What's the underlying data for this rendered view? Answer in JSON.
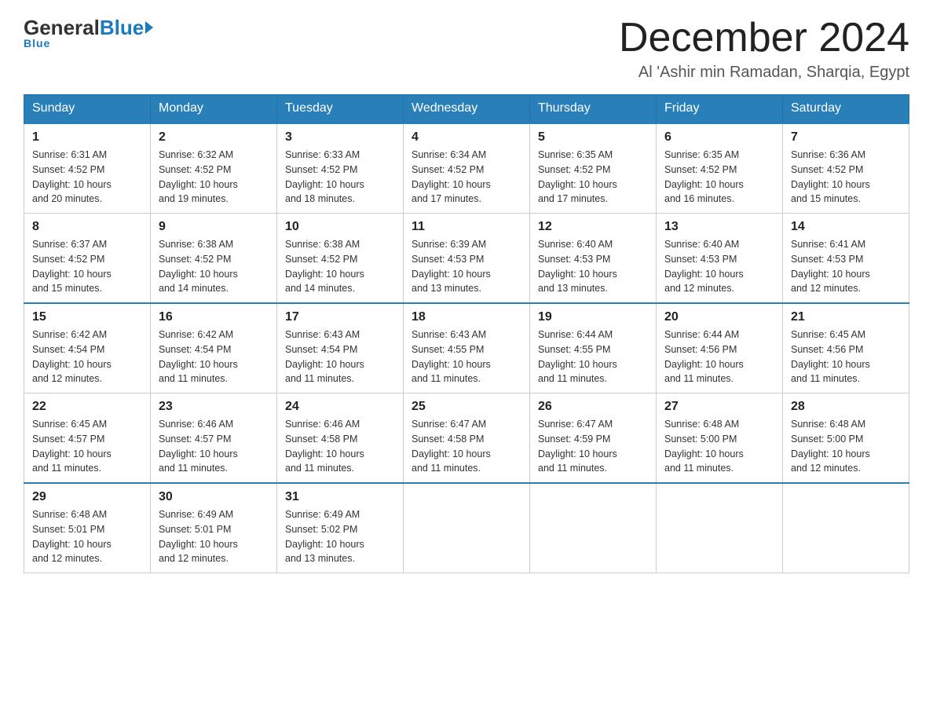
{
  "header": {
    "logo": {
      "general": "General",
      "blue": "Blue",
      "underline": "Blue"
    },
    "title": "December 2024",
    "location": "Al 'Ashir min Ramadan, Sharqia, Egypt"
  },
  "days_of_week": [
    "Sunday",
    "Monday",
    "Tuesday",
    "Wednesday",
    "Thursday",
    "Friday",
    "Saturday"
  ],
  "weeks": [
    [
      {
        "day": "1",
        "sunrise": "6:31 AM",
        "sunset": "4:52 PM",
        "daylight": "10 hours and 20 minutes."
      },
      {
        "day": "2",
        "sunrise": "6:32 AM",
        "sunset": "4:52 PM",
        "daylight": "10 hours and 19 minutes."
      },
      {
        "day": "3",
        "sunrise": "6:33 AM",
        "sunset": "4:52 PM",
        "daylight": "10 hours and 18 minutes."
      },
      {
        "day": "4",
        "sunrise": "6:34 AM",
        "sunset": "4:52 PM",
        "daylight": "10 hours and 17 minutes."
      },
      {
        "day": "5",
        "sunrise": "6:35 AM",
        "sunset": "4:52 PM",
        "daylight": "10 hours and 17 minutes."
      },
      {
        "day": "6",
        "sunrise": "6:35 AM",
        "sunset": "4:52 PM",
        "daylight": "10 hours and 16 minutes."
      },
      {
        "day": "7",
        "sunrise": "6:36 AM",
        "sunset": "4:52 PM",
        "daylight": "10 hours and 15 minutes."
      }
    ],
    [
      {
        "day": "8",
        "sunrise": "6:37 AM",
        "sunset": "4:52 PM",
        "daylight": "10 hours and 15 minutes."
      },
      {
        "day": "9",
        "sunrise": "6:38 AM",
        "sunset": "4:52 PM",
        "daylight": "10 hours and 14 minutes."
      },
      {
        "day": "10",
        "sunrise": "6:38 AM",
        "sunset": "4:52 PM",
        "daylight": "10 hours and 14 minutes."
      },
      {
        "day": "11",
        "sunrise": "6:39 AM",
        "sunset": "4:53 PM",
        "daylight": "10 hours and 13 minutes."
      },
      {
        "day": "12",
        "sunrise": "6:40 AM",
        "sunset": "4:53 PM",
        "daylight": "10 hours and 13 minutes."
      },
      {
        "day": "13",
        "sunrise": "6:40 AM",
        "sunset": "4:53 PM",
        "daylight": "10 hours and 12 minutes."
      },
      {
        "day": "14",
        "sunrise": "6:41 AM",
        "sunset": "4:53 PM",
        "daylight": "10 hours and 12 minutes."
      }
    ],
    [
      {
        "day": "15",
        "sunrise": "6:42 AM",
        "sunset": "4:54 PM",
        "daylight": "10 hours and 12 minutes."
      },
      {
        "day": "16",
        "sunrise": "6:42 AM",
        "sunset": "4:54 PM",
        "daylight": "10 hours and 11 minutes."
      },
      {
        "day": "17",
        "sunrise": "6:43 AM",
        "sunset": "4:54 PM",
        "daylight": "10 hours and 11 minutes."
      },
      {
        "day": "18",
        "sunrise": "6:43 AM",
        "sunset": "4:55 PM",
        "daylight": "10 hours and 11 minutes."
      },
      {
        "day": "19",
        "sunrise": "6:44 AM",
        "sunset": "4:55 PM",
        "daylight": "10 hours and 11 minutes."
      },
      {
        "day": "20",
        "sunrise": "6:44 AM",
        "sunset": "4:56 PM",
        "daylight": "10 hours and 11 minutes."
      },
      {
        "day": "21",
        "sunrise": "6:45 AM",
        "sunset": "4:56 PM",
        "daylight": "10 hours and 11 minutes."
      }
    ],
    [
      {
        "day": "22",
        "sunrise": "6:45 AM",
        "sunset": "4:57 PM",
        "daylight": "10 hours and 11 minutes."
      },
      {
        "day": "23",
        "sunrise": "6:46 AM",
        "sunset": "4:57 PM",
        "daylight": "10 hours and 11 minutes."
      },
      {
        "day": "24",
        "sunrise": "6:46 AM",
        "sunset": "4:58 PM",
        "daylight": "10 hours and 11 minutes."
      },
      {
        "day": "25",
        "sunrise": "6:47 AM",
        "sunset": "4:58 PM",
        "daylight": "10 hours and 11 minutes."
      },
      {
        "day": "26",
        "sunrise": "6:47 AM",
        "sunset": "4:59 PM",
        "daylight": "10 hours and 11 minutes."
      },
      {
        "day": "27",
        "sunrise": "6:48 AM",
        "sunset": "5:00 PM",
        "daylight": "10 hours and 11 minutes."
      },
      {
        "day": "28",
        "sunrise": "6:48 AM",
        "sunset": "5:00 PM",
        "daylight": "10 hours and 12 minutes."
      }
    ],
    [
      {
        "day": "29",
        "sunrise": "6:48 AM",
        "sunset": "5:01 PM",
        "daylight": "10 hours and 12 minutes."
      },
      {
        "day": "30",
        "sunrise": "6:49 AM",
        "sunset": "5:01 PM",
        "daylight": "10 hours and 12 minutes."
      },
      {
        "day": "31",
        "sunrise": "6:49 AM",
        "sunset": "5:02 PM",
        "daylight": "10 hours and 13 minutes."
      },
      null,
      null,
      null,
      null
    ]
  ],
  "labels": {
    "sunrise": "Sunrise:",
    "sunset": "Sunset:",
    "daylight": "Daylight:"
  }
}
